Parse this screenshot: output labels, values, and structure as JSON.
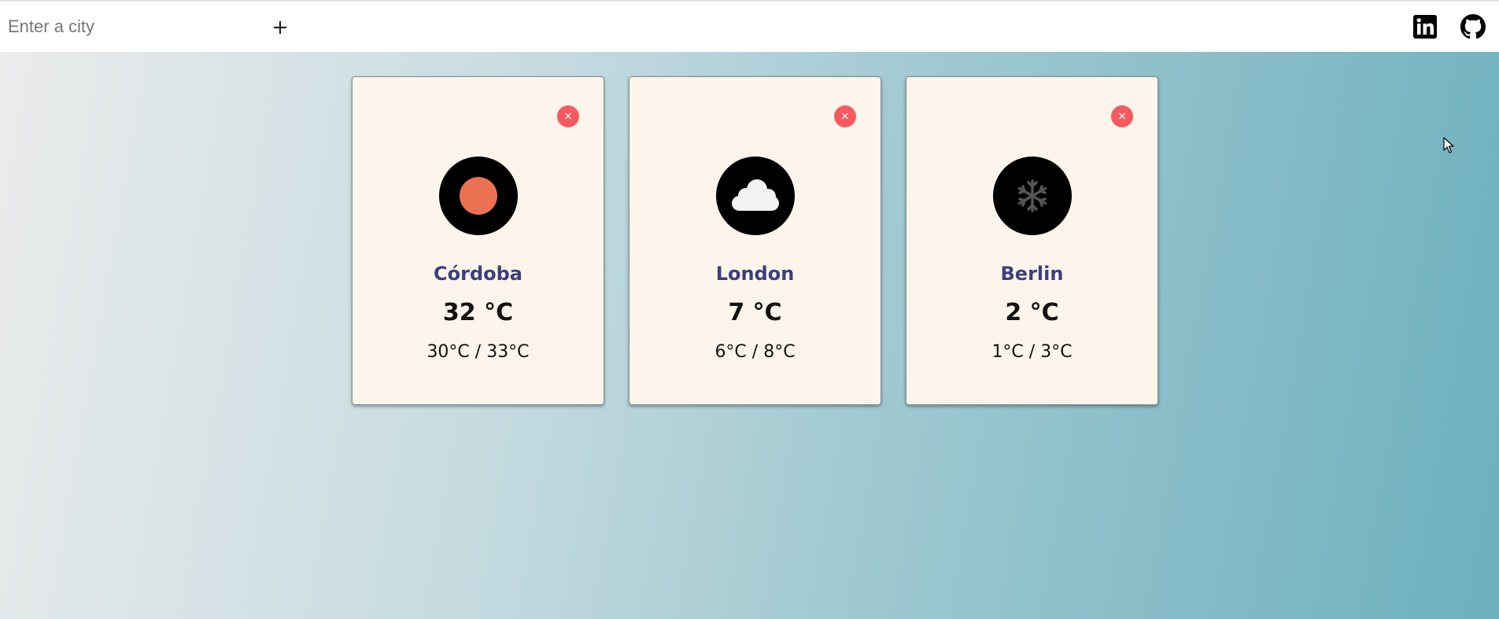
{
  "search": {
    "placeholder": "Enter a city",
    "add_label": "+"
  },
  "social": {
    "linkedin": "linkedin-icon",
    "github": "github-icon"
  },
  "cards": [
    {
      "city": "Córdoba",
      "temp": "32 °C",
      "range": "30°C / 33°C",
      "icon": "sun-icon",
      "icon_color": "#ec7153",
      "close_label": "×"
    },
    {
      "city": "London",
      "temp": "7 °C",
      "range": "6°C / 8°C",
      "icon": "cloud-icon",
      "icon_color": "#f2f2f2",
      "close_label": "×"
    },
    {
      "city": "Berlin",
      "temp": "2 °C",
      "range": "1°C / 3°C",
      "icon": "snowflake-icon",
      "icon_color": "#555555",
      "close_label": "×"
    }
  ],
  "colors": {
    "card_background": "#fdf5eb",
    "close_button": "#f45a5f",
    "city_name": "#3b3f7d"
  }
}
